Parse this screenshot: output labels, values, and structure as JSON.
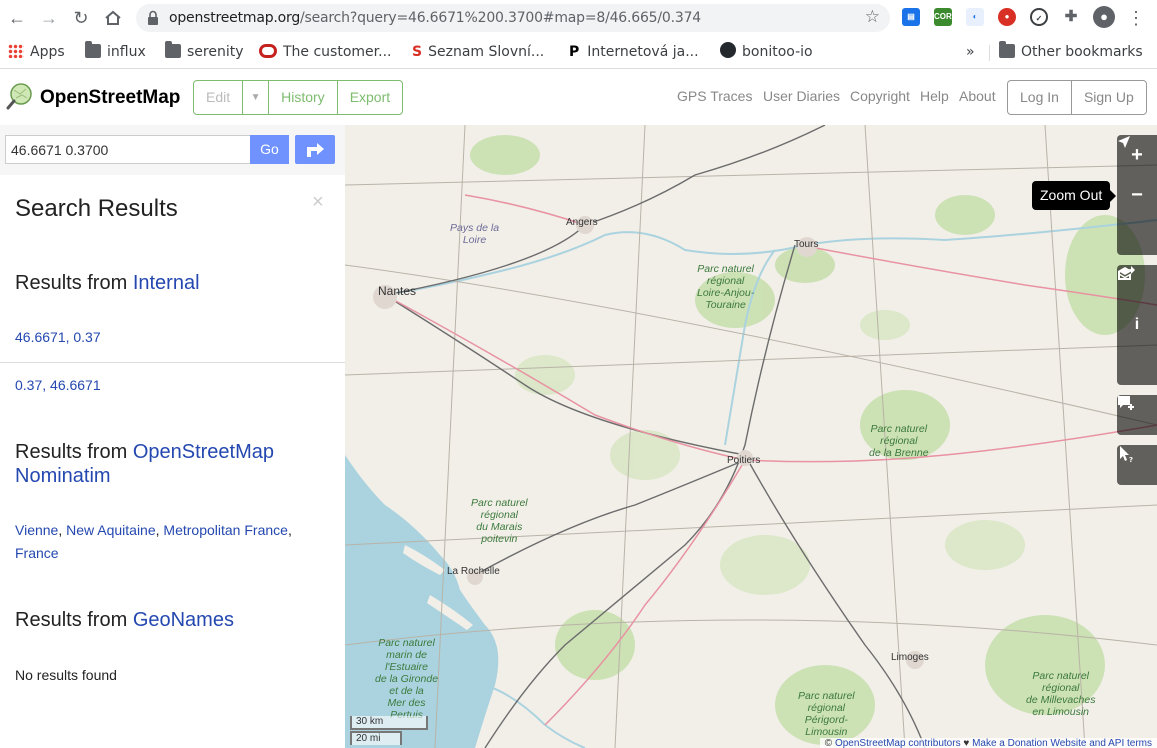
{
  "browser": {
    "url_host": "openstreetmap.org",
    "url_path": "/search?query=46.6671%200.3700#map=8/46.665/0.374",
    "bookmarks": [
      {
        "label": "Apps"
      },
      {
        "label": "influx"
      },
      {
        "label": "serenity"
      },
      {
        "label": "The customer..."
      },
      {
        "label": "Seznam Slovní..."
      },
      {
        "label": "Internetová ja..."
      },
      {
        "label": "bonitoo-io"
      }
    ],
    "more_bookmarks": "»",
    "other_bookmarks": "Other bookmarks"
  },
  "header": {
    "logo_text": "OpenStreetMap",
    "edit_label": "Edit",
    "history_label": "History",
    "export_label": "Export",
    "links": [
      "GPS Traces",
      "User Diaries",
      "Copyright",
      "Help",
      "About"
    ],
    "login_label": "Log In",
    "signup_label": "Sign Up"
  },
  "search": {
    "query": "46.6671 0.3700",
    "go_label": "Go"
  },
  "results": {
    "title": "Search Results",
    "close": "×",
    "internal_prefix": "Results from ",
    "internal_source": "Internal",
    "internal_items": [
      "46.6671, 0.37",
      "0.37, 46.6671"
    ],
    "nominatim_prefix": "Results from ",
    "nominatim_source_1": "OpenStreetMap",
    "nominatim_source_2": "Nominatim",
    "nominatim_item_parts": [
      "Vienne",
      ", ",
      "New Aquitaine",
      ", ",
      "Metropolitan France",
      ","
    ],
    "nominatim_item_line2": "France",
    "geonames_prefix": "Results from ",
    "geonames_source": "GeoNames",
    "no_results": "No results found"
  },
  "map": {
    "tooltip": "Zoom Out",
    "scale_km": "30 km",
    "scale_mi": "20 mi",
    "attribution_prefix": "© ",
    "attribution_link1": "OpenStreetMap contributors",
    "attribution_heart": " ♥ ",
    "attribution_link2": "Make a Donation",
    "attribution_link3": "Website and API terms",
    "cities": {
      "nantes": "Nantes",
      "angers": "Angers",
      "tours": "Tours",
      "poitiers": "Poitiers",
      "la_rochelle": "La Rochelle",
      "limoges": "Limoges"
    },
    "parks": {
      "pays_loire_1": "Pays de la",
      "pays_loire_2": "Loire",
      "loire_anjou_1": "Parc naturel",
      "loire_anjou_2": "régional",
      "loire_anjou_3": "Loire-Anjou-",
      "loire_anjou_4": "Touraine",
      "brenne_1": "Parc naturel",
      "brenne_2": "régional",
      "brenne_3": "de la Brenne",
      "marais_1": "Parc naturel",
      "marais_2": "régional",
      "marais_3": "du Marais",
      "marais_4": "poitevin",
      "gironde_1": "Parc naturel",
      "gironde_2": "marin de",
      "gironde_3": "l'Estuaire",
      "gironde_4": "de la Gironde",
      "gironde_5": "et de la",
      "gironde_6": "Mer des",
      "gironde_7": "Pertuis",
      "perigord_1": "Parc naturel",
      "perigord_2": "régional",
      "perigord_3": "Périgord-",
      "perigord_4": "Limousin",
      "millevaches_1": "Parc naturel",
      "millevaches_2": "régional",
      "millevaches_3": "de Millevaches",
      "millevaches_4": "en Limousin"
    }
  }
}
